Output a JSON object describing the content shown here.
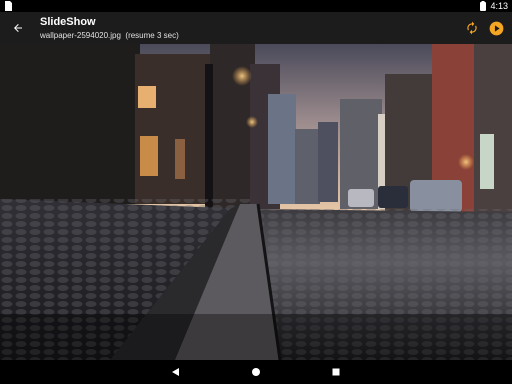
{
  "status_bar": {
    "time": "4:13",
    "icons": [
      "sim-card-icon",
      "battery-icon"
    ]
  },
  "app_bar": {
    "title": "SlideShow",
    "filename": "wallpaper-2594020.jpg",
    "resume_note": "(resume 3 sec)",
    "accent_color": "#f5a623",
    "icons": [
      "back-arrow-icon",
      "refresh-icon",
      "play-circle-icon"
    ]
  },
  "photo": {
    "subject": "cobblestone-street-at-dusk"
  },
  "nav_bar": {
    "icons": [
      "back-triangle-icon",
      "home-circle-icon",
      "recents-square-icon"
    ]
  }
}
